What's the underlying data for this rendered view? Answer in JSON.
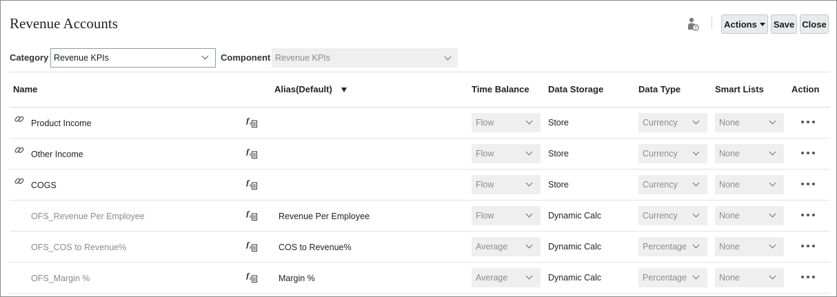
{
  "page": {
    "title": "Revenue Accounts"
  },
  "toolbar": {
    "help_icon": "user-help-icon",
    "actions_label": "Actions",
    "save_label": "Save",
    "close_label": "Close"
  },
  "filters": {
    "category_label": "Category",
    "category_value": "Revenue KPIs",
    "component_label": "Component",
    "component_value": "Revenue KPIs"
  },
  "table": {
    "columns": {
      "name": "Name",
      "alias": "Alias(Default)",
      "time_balance": "Time Balance",
      "data_storage": "Data Storage",
      "data_type": "Data Type",
      "smart_lists": "Smart Lists",
      "action": "Action"
    },
    "rows": [
      {
        "name": "Product Income",
        "alias": "",
        "time_balance": "Flow",
        "data_storage": "Store",
        "data_type": "Currency",
        "smart_list": "None"
      },
      {
        "name": "Other Income",
        "alias": "",
        "time_balance": "Flow",
        "data_storage": "Store",
        "data_type": "Currency",
        "smart_list": "None"
      },
      {
        "name": "COGS",
        "alias": "",
        "time_balance": "Flow",
        "data_storage": "Store",
        "data_type": "Currency",
        "smart_list": "None"
      },
      {
        "name": "OFS_Revenue Per Employee",
        "alias": "Revenue Per Employee",
        "time_balance": "Flow",
        "data_storage": "Dynamic Calc",
        "data_type": "Currency",
        "smart_list": "None"
      },
      {
        "name": "OFS_COS to Revenue%",
        "alias": "COS to Revenue%",
        "time_balance": "Average",
        "data_storage": "Dynamic Calc",
        "data_type": "Percentage",
        "smart_list": "None"
      },
      {
        "name": "OFS_Margin %",
        "alias": "Margin %",
        "time_balance": "Average",
        "data_storage": "Dynamic Calc",
        "data_type": "Percentage",
        "smart_list": "None"
      }
    ]
  },
  "colors": {
    "border": "#8a8a8a",
    "disabled_bg": "#efefef",
    "muted_text": "#8a8a8a"
  }
}
